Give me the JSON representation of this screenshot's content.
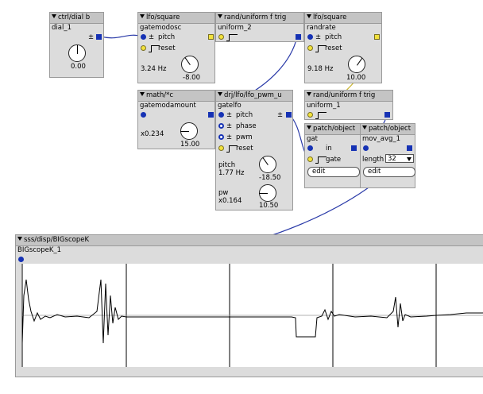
{
  "objects": {
    "dial": {
      "header": "ctrl/dial b",
      "instance": "dial_1",
      "pm": "±",
      "value": "0.00"
    },
    "lfo1": {
      "header": "lfo/square",
      "instance": "gatemodosc",
      "pm": "±",
      "pitch_label": "pitch",
      "reset_label": "reset",
      "freq": "3.24 Hz",
      "knob_value": "-8.00"
    },
    "rand1": {
      "header": "rand/uniform f trig",
      "instance": "uniform_2"
    },
    "lfo2": {
      "header": "lfo/square",
      "instance": "randrate",
      "pm": "±",
      "pitch_label": "pitch",
      "reset_label": "reset",
      "freq": "9.18 Hz",
      "knob_value": "10.00"
    },
    "math": {
      "header": "math/*c",
      "instance": "gatemodamount",
      "value": "x0.234",
      "knob_value": "15.00"
    },
    "pwm": {
      "header": "drj/lfo/lfo_pwm_u",
      "instance": "gatelfo",
      "pm": "±",
      "pitch_label": "pitch",
      "phase_label": "phase",
      "pwm_label": "pwm",
      "reset_label": "reset",
      "pitch_caption": "pitch",
      "pitch_freq": "1.77 Hz",
      "pitch_knob": "-18.50",
      "pw_caption": "pw",
      "pw_value": "x0.164",
      "pw_knob": "10.50"
    },
    "rand2": {
      "header": "rand/uniform f trig",
      "instance": "uniform_1"
    },
    "gat": {
      "header": "patch/object",
      "instance": "gat",
      "in_label": "in",
      "gate_label": "gate",
      "edit_label": "edit"
    },
    "mov": {
      "header": "patch/object",
      "instance": "mov_avg_1",
      "length_label": "length",
      "length_value": "32",
      "edit_label": "edit"
    },
    "scope": {
      "header": "sss/disp/BIGscopeK",
      "instance": "BIGscopeK_1"
    }
  },
  "colors": {
    "object_bg": "#dcdcdc",
    "header_bg": "#c4c4c4",
    "inlet_blue": "#1632b4",
    "wire_blue": "#2a3aa8",
    "wire_yellow": "#c9b32a"
  }
}
